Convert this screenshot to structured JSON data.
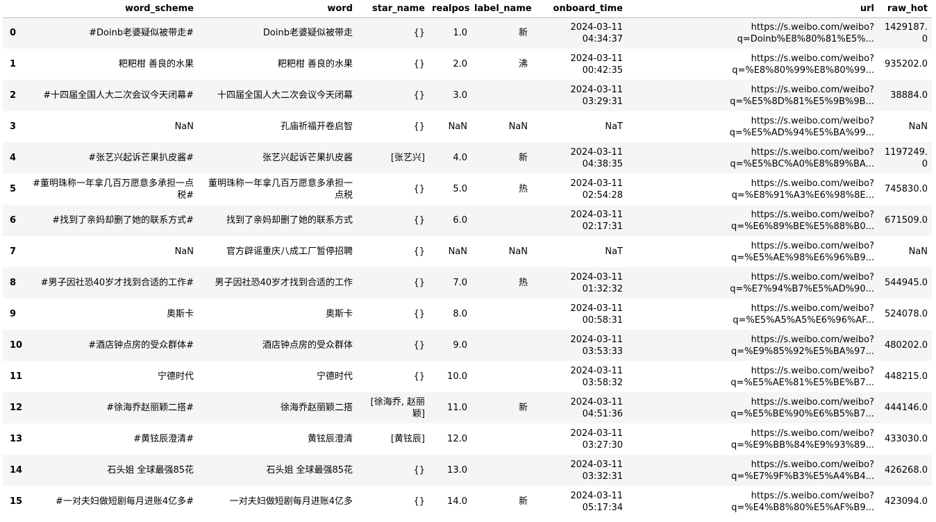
{
  "columns": {
    "index": "",
    "word_scheme": "word_scheme",
    "word": "word",
    "star_name": "star_name",
    "realpos": "realpos",
    "label_name": "label_name",
    "onboard_time": "onboard_time",
    "url": "url",
    "raw_hot": "raw_hot"
  },
  "rows": [
    {
      "index": "0",
      "word_scheme": "#Doinb老婆疑似被带走#",
      "word": "Doinb老婆疑似被带走",
      "star_name": "{}",
      "realpos": "1.0",
      "label_name": "新",
      "onboard_time": "2024-03-11\n04:34:37",
      "url": "https://s.weibo.com/weibo?\nq=Doinb%E8%80%81%E5%...",
      "raw_hot": "1429187.0"
    },
    {
      "index": "1",
      "word_scheme": "粑粑柑 善良的水果",
      "word": "粑粑柑 善良的水果",
      "star_name": "{}",
      "realpos": "2.0",
      "label_name": "沸",
      "onboard_time": "2024-03-11\n00:42:35",
      "url": "https://s.weibo.com/weibo?\nq=%E8%80%99%E8%80%99...",
      "raw_hot": "935202.0"
    },
    {
      "index": "2",
      "word_scheme": "#十四届全国人大二次会议今天闭幕#",
      "word": "十四届全国人大二次会议今天闭幕",
      "star_name": "{}",
      "realpos": "3.0",
      "label_name": "",
      "onboard_time": "2024-03-11\n03:29:31",
      "url": "https://s.weibo.com/weibo?\nq=%E5%8D%81%E5%9B%9B...",
      "raw_hot": "38884.0"
    },
    {
      "index": "3",
      "word_scheme": "NaN",
      "word": "孔庙祈福开卷启智",
      "star_name": "{}",
      "realpos": "NaN",
      "label_name": "NaN",
      "onboard_time": "NaT",
      "url": "https://s.weibo.com/weibo?\nq=%E5%AD%94%E5%BA%99...",
      "raw_hot": "NaN"
    },
    {
      "index": "4",
      "word_scheme": "#张艺兴起诉芒果扒皮酱#",
      "word": "张艺兴起诉芒果扒皮酱",
      "star_name": "[张艺兴]",
      "realpos": "4.0",
      "label_name": "新",
      "onboard_time": "2024-03-11\n04:38:35",
      "url": "https://s.weibo.com/weibo?\nq=%E5%BC%A0%E8%89%BA...",
      "raw_hot": "1197249.0"
    },
    {
      "index": "5",
      "word_scheme": "#董明珠称一年拿几百万愿意多承担一点税#",
      "word": "董明珠称一年拿几百万愿意多承担一点税",
      "star_name": "{}",
      "realpos": "5.0",
      "label_name": "热",
      "onboard_time": "2024-03-11\n02:54:28",
      "url": "https://s.weibo.com/weibo?\nq=%E8%91%A3%E6%98%8E...",
      "raw_hot": "745830.0"
    },
    {
      "index": "6",
      "word_scheme": "#找到了亲妈却删了她的联系方式#",
      "word": "找到了亲妈却删了她的联系方式",
      "star_name": "{}",
      "realpos": "6.0",
      "label_name": "",
      "onboard_time": "2024-03-11\n02:17:31",
      "url": "https://s.weibo.com/weibo?\nq=%E6%89%BE%E5%88%B0...",
      "raw_hot": "671509.0"
    },
    {
      "index": "7",
      "word_scheme": "NaN",
      "word": "官方辟谣重庆八成工厂暂停招聘",
      "star_name": "{}",
      "realpos": "NaN",
      "label_name": "NaN",
      "onboard_time": "NaT",
      "url": "https://s.weibo.com/weibo?\nq=%E5%AE%98%E6%96%B9...",
      "raw_hot": "NaN"
    },
    {
      "index": "8",
      "word_scheme": "#男子因社恐40岁才找到合适的工作#",
      "word": "男子因社恐40岁才找到合适的工作",
      "star_name": "{}",
      "realpos": "7.0",
      "label_name": "热",
      "onboard_time": "2024-03-11\n01:32:32",
      "url": "https://s.weibo.com/weibo?\nq=%E7%94%B7%E5%AD%90...",
      "raw_hot": "544945.0"
    },
    {
      "index": "9",
      "word_scheme": "奥斯卡",
      "word": "奥斯卡",
      "star_name": "{}",
      "realpos": "8.0",
      "label_name": "",
      "onboard_time": "2024-03-11\n00:58:31",
      "url": "https://s.weibo.com/weibo?\nq=%E5%A5%A5%E6%96%AF...",
      "raw_hot": "524078.0"
    },
    {
      "index": "10",
      "word_scheme": "#酒店钟点房的受众群体#",
      "word": "酒店钟点房的受众群体",
      "star_name": "{}",
      "realpos": "9.0",
      "label_name": "",
      "onboard_time": "2024-03-11\n03:53:33",
      "url": "https://s.weibo.com/weibo?\nq=%E9%85%92%E5%BA%97...",
      "raw_hot": "480202.0"
    },
    {
      "index": "11",
      "word_scheme": "宁德时代",
      "word": "宁德时代",
      "star_name": "{}",
      "realpos": "10.0",
      "label_name": "",
      "onboard_time": "2024-03-11\n03:58:32",
      "url": "https://s.weibo.com/weibo?\nq=%E5%AE%81%E5%BE%B7...",
      "raw_hot": "448215.0"
    },
    {
      "index": "12",
      "word_scheme": "#徐海乔赵丽颖二搭#",
      "word": "徐海乔赵丽颖二搭",
      "star_name": "[徐海乔, 赵丽颖]",
      "realpos": "11.0",
      "label_name": "新",
      "onboard_time": "2024-03-11\n04:51:36",
      "url": "https://s.weibo.com/weibo?\nq=%E5%BE%90%E6%B5%B7...",
      "raw_hot": "444146.0"
    },
    {
      "index": "13",
      "word_scheme": "#黄铉辰澄清#",
      "word": "黄铉辰澄清",
      "star_name": "[黄铉辰]",
      "realpos": "12.0",
      "label_name": "",
      "onboard_time": "2024-03-11\n03:27:30",
      "url": "https://s.weibo.com/weibo?\nq=%E9%BB%84%E9%93%89...",
      "raw_hot": "433030.0"
    },
    {
      "index": "14",
      "word_scheme": "石头姐 全球最强85花",
      "word": "石头姐 全球最强85花",
      "star_name": "{}",
      "realpos": "13.0",
      "label_name": "",
      "onboard_time": "2024-03-11\n03:32:31",
      "url": "https://s.weibo.com/weibo?\nq=%E7%9F%B3%E5%A4%B4...",
      "raw_hot": "426268.0"
    },
    {
      "index": "15",
      "word_scheme": "#一对夫妇做短剧每月进账4亿多#",
      "word": "一对夫妇做短剧每月进账4亿多",
      "star_name": "{}",
      "realpos": "14.0",
      "label_name": "新",
      "onboard_time": "2024-03-11\n05:17:34",
      "url": "https://s.weibo.com/weibo?\nq=%E4%B8%80%E5%AF%B9...",
      "raw_hot": "423094.0"
    }
  ]
}
